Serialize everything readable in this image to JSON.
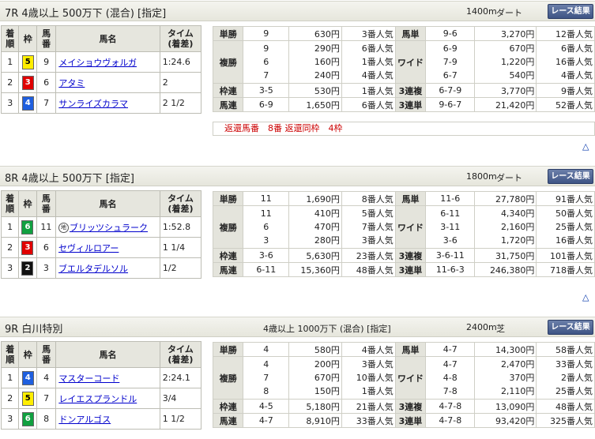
{
  "race_button_label": "レース結果",
  "finish_headers": {
    "rank": "着\n順",
    "waku": "枠",
    "num": "馬\n番",
    "name": "馬名",
    "time": "タイム\n(着差)"
  },
  "bet_labels": {
    "win": "単勝",
    "place": "複勝",
    "bracket": "枠連",
    "quinella": "馬連",
    "exacta": "馬単",
    "wide": "ワイド",
    "trio": "3連複",
    "trifecta": "3連単"
  },
  "up_icon": "triangle-up-icon",
  "colors": {
    "waku1": "#ffffff",
    "waku2": "#111111",
    "waku3": "#e00000",
    "waku4": "#1f5fdf",
    "waku5": "#ffee00",
    "waku6": "#10a040",
    "button": "#3e5485",
    "refund_text": "#cc0000"
  },
  "races": [
    {
      "title": "7R 4歳以上 500万下 (混合) [指定]",
      "cond": "",
      "distance": "1400m",
      "surface": "ダート",
      "finishers": [
        {
          "rank": "1",
          "waku": "5",
          "num": "9",
          "name": "メイショウヴォルガ",
          "mark": "",
          "time": "1:24.6"
        },
        {
          "rank": "2",
          "waku": "3",
          "num": "6",
          "name": "アタミ",
          "mark": "",
          "time": "2"
        },
        {
          "rank": "3",
          "waku": "4",
          "num": "7",
          "name": "サンライズカラマ",
          "mark": "",
          "time": "2 1/2"
        }
      ],
      "win": {
        "num": "9",
        "yen": "630円",
        "pop": "3番人気"
      },
      "place": {
        "nums": "9\n6\n7",
        "yen": "290円\n160円\n240円",
        "pop": "6番人気\n1番人気\n4番人気"
      },
      "bracket": {
        "num": "3-5",
        "yen": "530円",
        "pop": "1番人気"
      },
      "quinella": {
        "num": "6-9",
        "yen": "1,650円",
        "pop": "6番人気"
      },
      "exacta": {
        "num": "9-6",
        "yen": "3,270円",
        "pop": "12番人気"
      },
      "wide": {
        "nums": "6-9\n7-9\n6-7",
        "yen": "670円\n1,220円\n540円",
        "pop": "6番人気\n16番人気\n4番人気"
      },
      "trio": {
        "num": "6-7-9",
        "yen": "3,770円",
        "pop": "9番人気"
      },
      "trifecta": {
        "num": "9-6-7",
        "yen": "21,420円",
        "pop": "52番人気"
      },
      "refund": "返還馬番　8番 返還同枠　4枠"
    },
    {
      "title": "8R 4歳以上 500万下 [指定]",
      "cond": "",
      "distance": "1800m",
      "surface": "ダート",
      "finishers": [
        {
          "rank": "1",
          "waku": "6",
          "num": "11",
          "name": "ブリッツシュラーク",
          "mark": "地",
          "time": "1:52.8"
        },
        {
          "rank": "2",
          "waku": "3",
          "num": "6",
          "name": "セヴィルロアー",
          "mark": "",
          "time": "1 1/4"
        },
        {
          "rank": "3",
          "waku": "2",
          "num": "3",
          "name": "ブエルタデルソル",
          "mark": "",
          "time": "1/2"
        }
      ],
      "win": {
        "num": "11",
        "yen": "1,690円",
        "pop": "8番人気"
      },
      "place": {
        "nums": "11\n6\n3",
        "yen": "410円\n470円\n280円",
        "pop": "5番人気\n7番人気\n3番人気"
      },
      "bracket": {
        "num": "3-6",
        "yen": "5,630円",
        "pop": "23番人気"
      },
      "quinella": {
        "num": "6-11",
        "yen": "15,360円",
        "pop": "48番人気"
      },
      "exacta": {
        "num": "11-6",
        "yen": "27,780円",
        "pop": "91番人気"
      },
      "wide": {
        "nums": "6-11\n3-11\n3-6",
        "yen": "4,340円\n2,160円\n1,720円",
        "pop": "50番人気\n25番人気\n16番人気"
      },
      "trio": {
        "num": "3-6-11",
        "yen": "31,750円",
        "pop": "101番人気"
      },
      "trifecta": {
        "num": "11-6-3",
        "yen": "246,380円",
        "pop": "718番人気"
      },
      "refund": ""
    },
    {
      "title": "9R 白川特別",
      "cond": "4歳以上 1000万下 (混合) [指定]",
      "distance": "2400m",
      "surface": "芝",
      "finishers": [
        {
          "rank": "1",
          "waku": "4",
          "num": "4",
          "name": "マスターコード",
          "mark": "",
          "time": "2:24.1"
        },
        {
          "rank": "2",
          "waku": "5",
          "num": "7",
          "name": "レイエスプランドル",
          "mark": "",
          "time": "3/4"
        },
        {
          "rank": "3",
          "waku": "6",
          "num": "8",
          "name": "ドンアルゴス",
          "mark": "",
          "time": "1 1/2"
        }
      ],
      "win": {
        "num": "4",
        "yen": "580円",
        "pop": "4番人気"
      },
      "place": {
        "nums": "4\n7\n8",
        "yen": "200円\n670円\n150円",
        "pop": "3番人気\n10番人気\n1番人気"
      },
      "bracket": {
        "num": "4-5",
        "yen": "5,180円",
        "pop": "21番人気"
      },
      "quinella": {
        "num": "4-7",
        "yen": "8,910円",
        "pop": "33番人気"
      },
      "exacta": {
        "num": "4-7",
        "yen": "14,300円",
        "pop": "58番人気"
      },
      "wide": {
        "nums": "4-7\n4-8\n7-8",
        "yen": "2,470円\n370円\n2,110円",
        "pop": "33番人気\n2番人気\n25番人気"
      },
      "trio": {
        "num": "4-7-8",
        "yen": "13,090円",
        "pop": "48番人気"
      },
      "trifecta": {
        "num": "4-7-8",
        "yen": "93,420円",
        "pop": "325番人気"
      },
      "refund": ""
    }
  ]
}
